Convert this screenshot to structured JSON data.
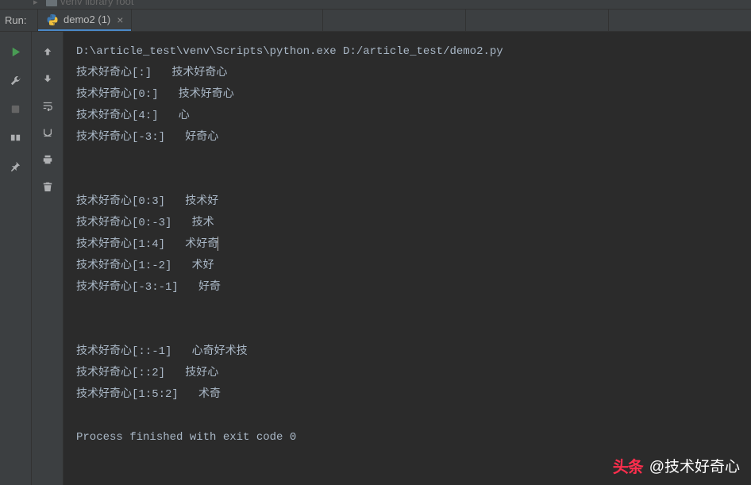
{
  "tree": {
    "item": "venv  library root"
  },
  "tabBar": {
    "runLabel": "Run:",
    "tabName": "demo2 (1)"
  },
  "console": {
    "lines": [
      "D:\\article_test\\venv\\Scripts\\python.exe D:/article_test/demo2.py",
      "技术好奇心[:]   技术好奇心",
      "技术好奇心[0:]   技术好奇心",
      "技术好奇心[4:]   心",
      "技术好奇心[-3:]   好奇心",
      "",
      "",
      "技术好奇心[0:3]   技术好",
      "技术好奇心[0:-3]   技术",
      "技术好奇心[1:4]   术好奇",
      "技术好奇心[1:-2]   术好",
      "技术好奇心[-3:-1]   好奇",
      "",
      "",
      "技术好奇心[::-1]   心奇好术技",
      "技术好奇心[::2]   技好心",
      "技术好奇心[1:5:2]   术奇",
      "",
      "Process finished with exit code 0"
    ]
  },
  "watermark": {
    "logo": "头条",
    "handle": "@技术好奇心"
  }
}
